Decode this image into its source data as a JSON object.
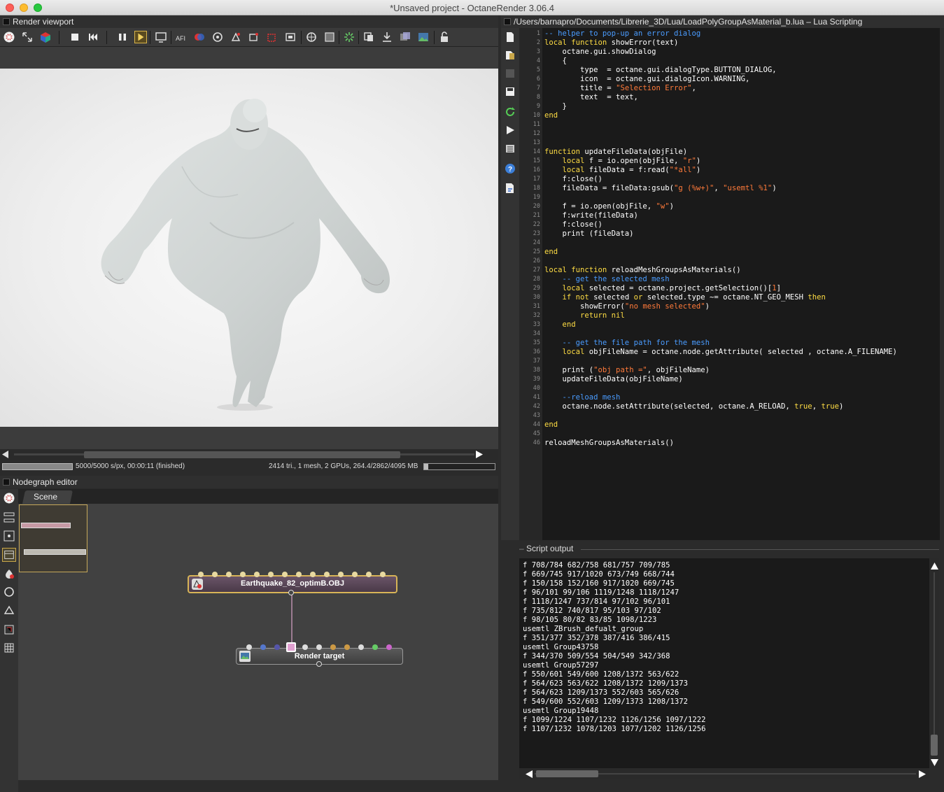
{
  "window": {
    "title": "*Unsaved project - OctaneRender 3.06.4"
  },
  "render_viewport": {
    "title": "Render viewport",
    "status_left": "5000/5000 s/px, 00:00:11 (finished)",
    "status_right": "2414 tri., 1 mesh, 2 GPUs, 264.4/2862/4095 MB"
  },
  "nodegraph": {
    "title": "Nodegraph editor",
    "tab": "Scene",
    "mesh_node_label": "Earthquake_82_optimB.OBJ",
    "render_target_label": "Render target"
  },
  "lua": {
    "title": "/Users/barnapro/Documents/Librerie_3D/Lua/LoadPolyGroupAsMaterial_b.lua – Lua Scripting",
    "code": [
      [
        [
          "cm",
          "-- helper to pop-up an error dialog"
        ]
      ],
      [
        [
          "kw",
          "local function"
        ],
        [
          "pl",
          " showError(text)"
        ]
      ],
      [
        [
          "pl",
          "    octane.gui.showDialog"
        ]
      ],
      [
        [
          "pl",
          "    {"
        ]
      ],
      [
        [
          "pl",
          "        type  = octane.gui.dialogType.BUTTON_DIALOG,"
        ]
      ],
      [
        [
          "pl",
          "        icon  = octane.gui.dialogIcon.WARNING,"
        ]
      ],
      [
        [
          "pl",
          "        title = "
        ],
        [
          "st",
          "\"Selection Error\""
        ],
        [
          "pl",
          ","
        ]
      ],
      [
        [
          "pl",
          "        text  = text,"
        ]
      ],
      [
        [
          "pl",
          "    }"
        ]
      ],
      [
        [
          "kw",
          "end"
        ]
      ],
      [],
      [],
      [],
      [
        [
          "kw",
          "function"
        ],
        [
          "pl",
          " updateFileData(objFile)"
        ]
      ],
      [
        [
          "pl",
          "    "
        ],
        [
          "kw",
          "local"
        ],
        [
          "pl",
          " f = io.open(objFile, "
        ],
        [
          "st",
          "\"r\""
        ],
        [
          "pl",
          ")"
        ]
      ],
      [
        [
          "pl",
          "    "
        ],
        [
          "kw",
          "local"
        ],
        [
          "pl",
          " fileData = f:read("
        ],
        [
          "st",
          "\"*all\""
        ],
        [
          "pl",
          ")"
        ]
      ],
      [
        [
          "pl",
          "    f:close()"
        ]
      ],
      [
        [
          "pl",
          "    fileData = fileData:gsub("
        ],
        [
          "st",
          "\"g (%w+)\""
        ],
        [
          "pl",
          ", "
        ],
        [
          "st",
          "\"usemtl %1\""
        ],
        [
          "pl",
          ")"
        ]
      ],
      [],
      [
        [
          "pl",
          "    f = io.open(objFile, "
        ],
        [
          "st",
          "\"w\""
        ],
        [
          "pl",
          ")"
        ]
      ],
      [
        [
          "pl",
          "    f:write(fileData)"
        ]
      ],
      [
        [
          "pl",
          "    f:close()"
        ]
      ],
      [
        [
          "pl",
          "    print (fileData)"
        ]
      ],
      [],
      [
        [
          "kw",
          "end"
        ]
      ],
      [],
      [
        [
          "kw",
          "local function"
        ],
        [
          "pl",
          " reloadMeshGroupsAsMaterials()"
        ]
      ],
      [
        [
          "pl",
          "    "
        ],
        [
          "cm",
          "-- get the selected mesh"
        ]
      ],
      [
        [
          "pl",
          "    "
        ],
        [
          "kw",
          "local"
        ],
        [
          "pl",
          " selected = octane.project.getSelection()["
        ],
        [
          "st",
          "1"
        ],
        [
          "pl",
          "]"
        ]
      ],
      [
        [
          "pl",
          "    "
        ],
        [
          "kw",
          "if not"
        ],
        [
          "pl",
          " selected "
        ],
        [
          "kw",
          "or"
        ],
        [
          "pl",
          " selected.type ~= octane.NT_GEO_MESH "
        ],
        [
          "kw",
          "then"
        ]
      ],
      [
        [
          "pl",
          "        showError("
        ],
        [
          "st",
          "\"no mesh selected\""
        ],
        [
          "pl",
          ")"
        ]
      ],
      [
        [
          "pl",
          "        "
        ],
        [
          "kw",
          "return nil"
        ]
      ],
      [
        [
          "pl",
          "    "
        ],
        [
          "kw",
          "end"
        ]
      ],
      [],
      [
        [
          "pl",
          "    "
        ],
        [
          "cm",
          "-- get the file path for the mesh"
        ]
      ],
      [
        [
          "pl",
          "    "
        ],
        [
          "kw",
          "local"
        ],
        [
          "pl",
          " objFileName = octane.node.getAttribute( selected , octane.A_FILENAME)"
        ]
      ],
      [],
      [
        [
          "pl",
          "    print ("
        ],
        [
          "st",
          "\"obj path =\""
        ],
        [
          "pl",
          ", objFileName)"
        ]
      ],
      [
        [
          "pl",
          "    updateFileData(objFileName)"
        ]
      ],
      [],
      [
        [
          "pl",
          "    "
        ],
        [
          "cm",
          "--reload mesh"
        ]
      ],
      [
        [
          "pl",
          "    octane.node.setAttribute(selected, octane.A_RELOAD, "
        ],
        [
          "kw",
          "true"
        ],
        [
          "pl",
          ", "
        ],
        [
          "kw",
          "true"
        ],
        [
          "pl",
          ")"
        ]
      ],
      [],
      [
        [
          "kw",
          "end"
        ]
      ],
      [],
      [
        [
          "pl",
          "reloadMeshGroupsAsMaterials()"
        ]
      ]
    ]
  },
  "script_output": {
    "label": "Script output",
    "lines": [
      "f 708/784 682/758 681/757 709/785",
      "f 669/745 917/1020 673/749 668/744",
      "f 150/158 152/160 917/1020 669/745",
      "f 96/101 99/106 1119/1248 1118/1247",
      "f 1118/1247 737/814 97/102 96/101",
      "f 735/812 740/817 95/103 97/102",
      "f 98/105 80/82 83/85 1098/1223",
      "usemtl ZBrush_defualt_group",
      "f 351/377 352/378 387/416 386/415",
      "usemtl Group43758",
      "f 344/370 509/554 504/549 342/368",
      "usemtl Group57297",
      "f 550/601 549/600 1208/1372 563/622",
      "f 564/623 563/622 1208/1372 1209/1373",
      "f 564/623 1209/1373 552/603 565/626",
      "f 549/600 552/603 1209/1373 1208/1372",
      "usemtl Group19448",
      "f 1099/1224 1107/1232 1126/1256 1097/1222",
      "f 1107/1232 1078/1203 1077/1202 1126/1256"
    ]
  }
}
